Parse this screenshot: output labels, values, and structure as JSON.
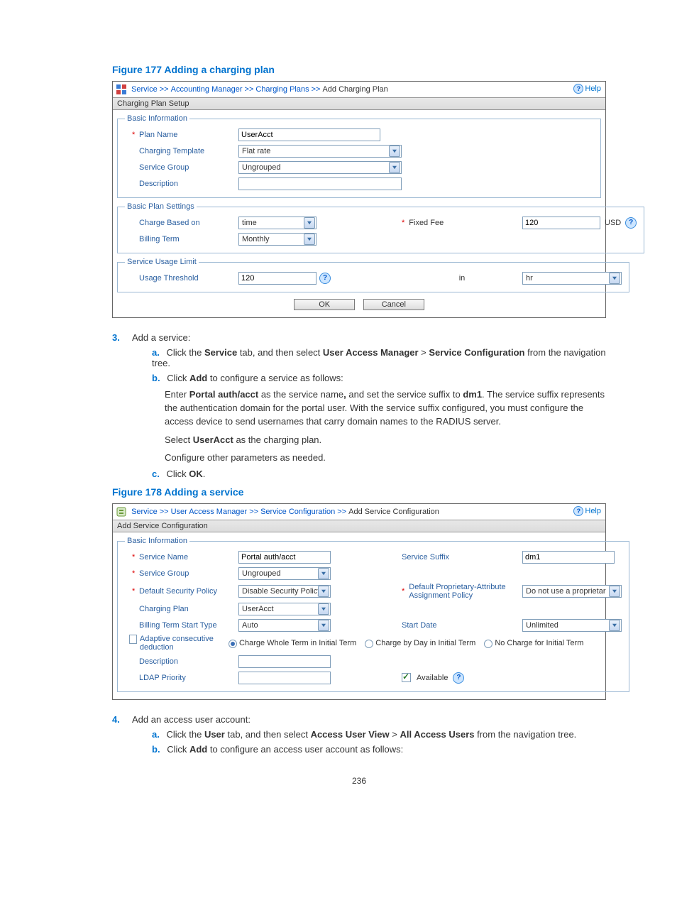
{
  "fig177": {
    "title": "Figure 177 Adding a charging plan",
    "bc": [
      "Service",
      "Accounting Manager",
      "Charging Plans",
      "Add Charging Plan"
    ],
    "help": "Help",
    "section": "Charging Plan Setup",
    "basicInfo": {
      "legend": "Basic Information",
      "planName_lbl": "Plan Name",
      "planName_val": "UserAcct",
      "chargingTemplate_lbl": "Charging Template",
      "chargingTemplate_val": "Flat rate",
      "serviceGroup_lbl": "Service Group",
      "serviceGroup_val": "Ungrouped",
      "description_lbl": "Description",
      "description_val": ""
    },
    "planSettings": {
      "legend": "Basic Plan Settings",
      "chargeBased_lbl": "Charge Based on",
      "chargeBased_val": "time",
      "fixedFee_lbl": "Fixed Fee",
      "fixedFee_val": "120",
      "fixedFee_cur": "USD",
      "billingTerm_lbl": "Billing Term",
      "billingTerm_val": "Monthly"
    },
    "usageLimit": {
      "legend": "Service Usage Limit",
      "threshold_lbl": "Usage Threshold",
      "threshold_val": "120",
      "in_lbl": "in",
      "in_val": "hr"
    },
    "buttons": {
      "ok": "OK",
      "cancel": "Cancel"
    }
  },
  "step3": {
    "num": "3.",
    "title": "Add a service:",
    "a_pre": "Click the ",
    "a_b1": "Service",
    "a_mid1": " tab, and then select ",
    "a_b2": "User Access Manager",
    "a_gt": " > ",
    "a_b3": "Service Configuration",
    "a_post": " from the navigation tree.",
    "b_pre": "Click ",
    "b_b1": "Add",
    "b_post": " to configure a service as follows:",
    "p1_pre": "Enter ",
    "p1_b1": "Portal auth/acct",
    "p1_mid1": " as the service name",
    "p1_comma": ",",
    "p1_mid2": " and set the service suffix to ",
    "p1_b2": "dm1",
    "p1_post": ". The service suffix represents the authentication domain for the portal user. With the service suffix configured, you must configure the access device to send usernames that carry domain names to the RADIUS server.",
    "p2_pre": "Select ",
    "p2_b1": "UserAcct",
    "p2_post": " as the charging plan.",
    "p3": "Configure other parameters as needed.",
    "c_pre": "Click ",
    "c_b1": "OK",
    "c_post": "."
  },
  "fig178": {
    "title": "Figure 178 Adding a service",
    "bc": [
      "Service",
      "User Access Manager",
      "Service Configuration",
      "Add Service Configuration"
    ],
    "bc_sep_last": ">>",
    "help": "Help",
    "section": "Add Service Configuration",
    "basicInfo": {
      "legend": "Basic Information",
      "serviceName_lbl": "Service Name",
      "serviceName_val": "Portal auth/acct",
      "serviceSuffix_lbl": "Service Suffix",
      "serviceSuffix_val": "dm1",
      "serviceGroup_lbl": "Service Group",
      "serviceGroup_val": "Ungrouped",
      "defSec_lbl": "Default Security Policy",
      "defSec_val": "Disable Security Policy",
      "defProp_lbl": "Default Proprietary-Attribute Assignment Policy",
      "defProp_val": "Do not use a proprietar",
      "chargingPlan_lbl": "Charging Plan",
      "chargingPlan_val": "UserAcct",
      "billingStart_lbl": "Billing Term Start Type",
      "billingStart_val": "Auto",
      "startDate_lbl": "Start Date",
      "startDate_val": "Unlimited",
      "adaptive_lbl": "Adaptive consecutive deduction",
      "rad1": "Charge Whole Term in Initial Term",
      "rad2": "Charge by Day in Initial Term",
      "rad3": "No Charge for Initial Term",
      "description_lbl": "Description",
      "description_val": "",
      "ldap_lbl": "LDAP Priority",
      "ldap_val": "",
      "available_lbl": "Available"
    }
  },
  "step4": {
    "num": "4.",
    "title": "Add an access user account:",
    "a_pre": "Click the ",
    "a_b1": "User",
    "a_mid1": " tab, and then select ",
    "a_b2": "Access User View",
    "a_gt": " > ",
    "a_b3": "All Access Users",
    "a_post": " from the navigation tree.",
    "b_pre": "Click ",
    "b_b1": "Add",
    "b_post": " to configure an access user account as follows:"
  },
  "pageNumber": "236"
}
